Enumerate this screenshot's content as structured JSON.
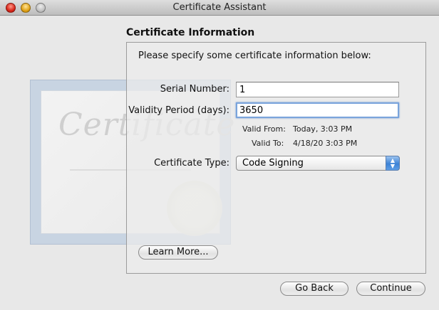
{
  "window": {
    "title": "Certificate Assistant"
  },
  "section": {
    "title": "Certificate Information",
    "intro": "Please specify some certificate information below:"
  },
  "fields": {
    "serial_number": {
      "label": "Serial Number:",
      "value": "1"
    },
    "validity_period": {
      "label": "Validity Period (days):",
      "value": "3650"
    },
    "valid_from": {
      "label": "Valid From:",
      "value": "Today, 3:03 PM"
    },
    "valid_to": {
      "label": "Valid To:",
      "value": "4/18/20 3:03 PM"
    },
    "certificate_type": {
      "label": "Certificate Type:",
      "value": "Code Signing"
    }
  },
  "background_art": {
    "word": "Certificate"
  },
  "buttons": {
    "learn_more": "Learn More...",
    "go_back": "Go Back",
    "continue": "Continue"
  },
  "colors": {
    "focus_ring": "#7aa4dc",
    "popup_accent": "#3d83d6"
  }
}
